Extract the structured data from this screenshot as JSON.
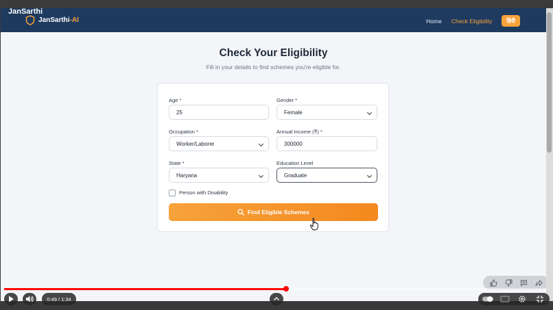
{
  "video": {
    "title": "JanSarthi",
    "time": "0:49 / 1:34",
    "progress": 0.52
  },
  "site": {
    "logo_main": "JanSarthi",
    "logo_sep": "-",
    "logo_ai": "AI",
    "nav": {
      "home": "Home",
      "check_eligibility": "Check Eligibility",
      "language": "हिंदी"
    }
  },
  "page": {
    "title": "Check Your Eligibility",
    "subtitle": "Fill in your details to find schemes you're eligible for."
  },
  "form": {
    "age": {
      "label": "Age *",
      "value": "25"
    },
    "gender": {
      "label": "Gender *",
      "value": "Female"
    },
    "occupation": {
      "label": "Occupation *",
      "value": "Worker/Laborer"
    },
    "income": {
      "label": "Annual Income (₹) *",
      "value": "300000"
    },
    "state": {
      "label": "State *",
      "value": "Haryana"
    },
    "education": {
      "label": "Education Level",
      "value": "Graduate"
    },
    "disability": {
      "label": "Person with Disability",
      "checked": false
    },
    "submit_label": "Find Eligible Schemes"
  },
  "colors": {
    "header_bg": "#1e3a5f",
    "accent": "#f7a23b",
    "progress": "#ff0000"
  }
}
